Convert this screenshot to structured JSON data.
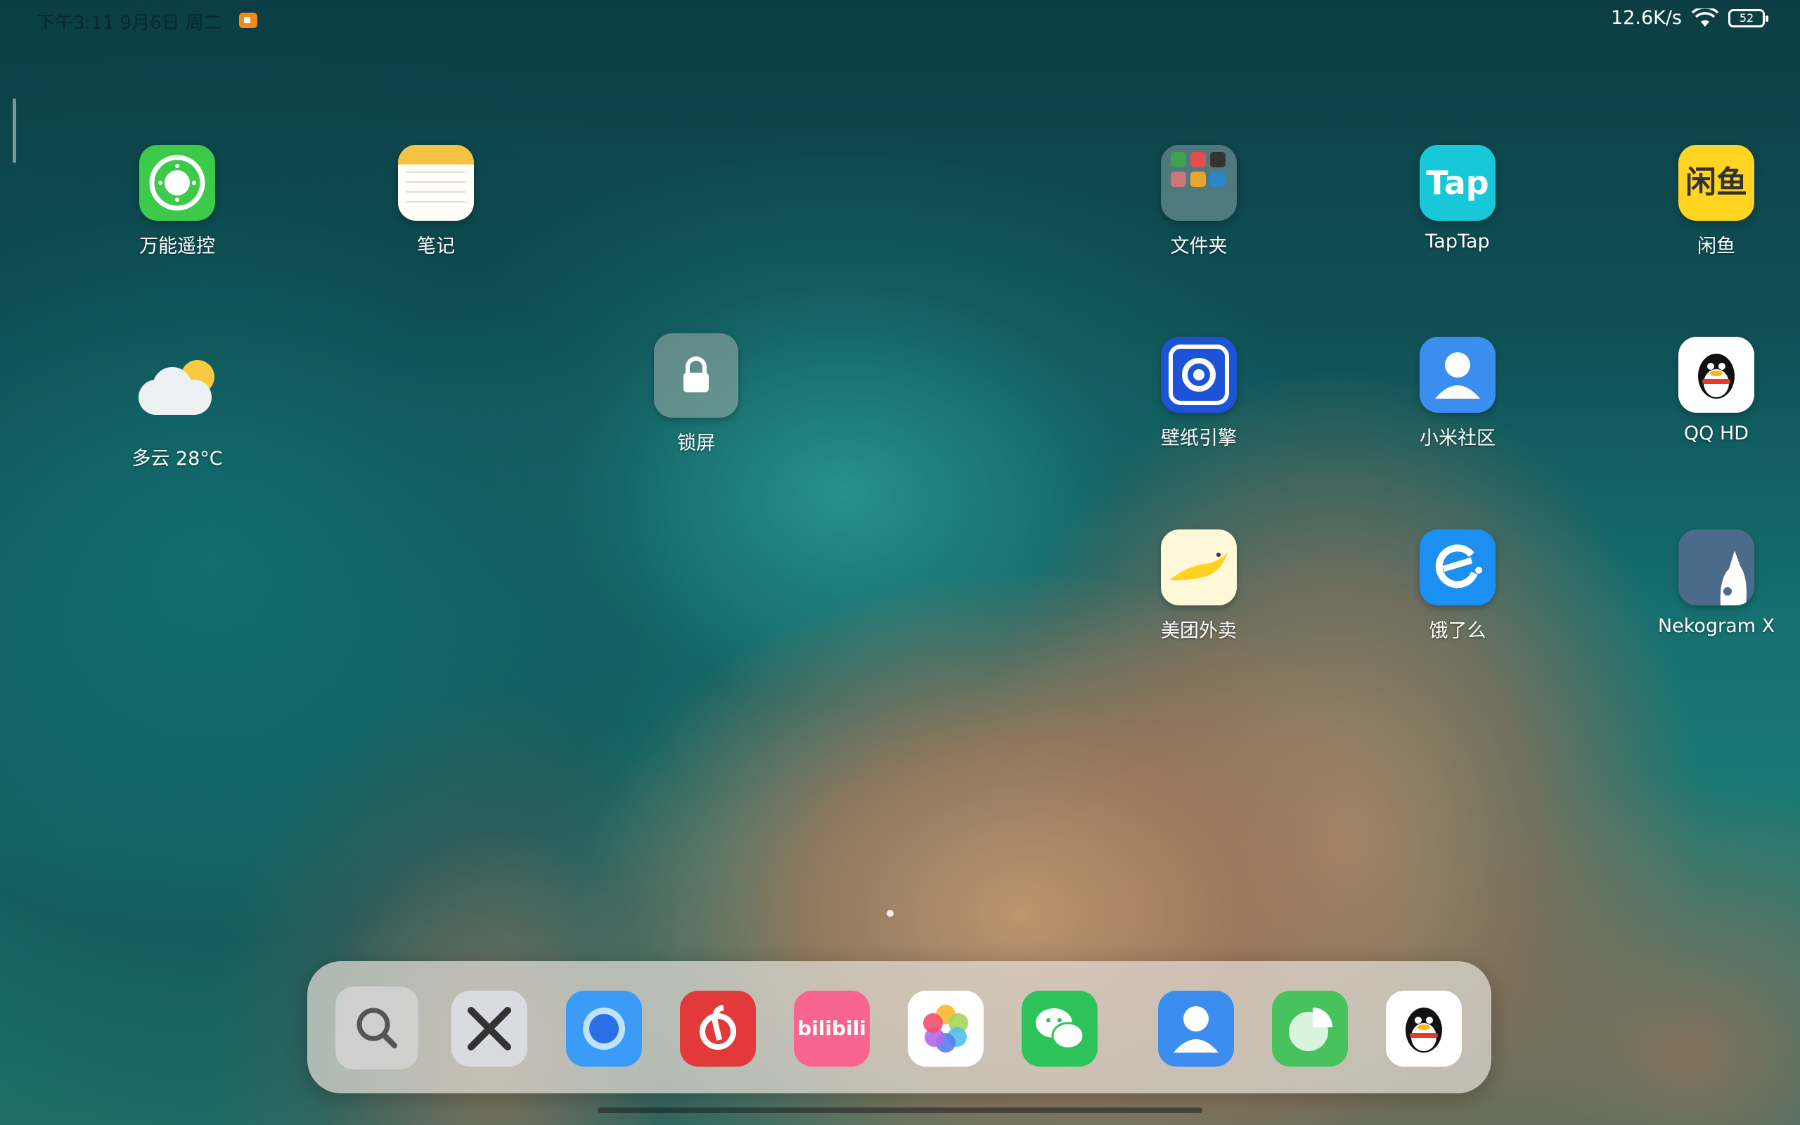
{
  "status": {
    "time_date": "下午3:11 9月6日 周二",
    "net_speed": "12.6K/s",
    "battery": "52"
  },
  "apps": {
    "remote": "万能遥控",
    "notes": "笔记",
    "folder": "文件夹",
    "taptap": "TapTap",
    "taptap_logo": "Tap",
    "xianyu": "闲鱼",
    "xianyu_logo": "闲鱼",
    "weather": "多云 28°C",
    "lock": "锁屏",
    "wallpaper": "壁纸引擎",
    "community": "小米社区",
    "qqhd": "QQ HD",
    "meituan": "美团外卖",
    "eleme": "饿了么",
    "nekogram": "Nekogram X"
  },
  "dock": {
    "bilibili_logo": "bilibili"
  },
  "colors": {
    "remote": "#3dc94a",
    "notes": "#f4c343",
    "taptap": "#19c8d8",
    "xianyu": "#ffd522",
    "wallpaper": "#1d53d6",
    "community": "#3c8df0",
    "eleme": "#1b8ff2",
    "nekogram": "#4b6b8a"
  }
}
